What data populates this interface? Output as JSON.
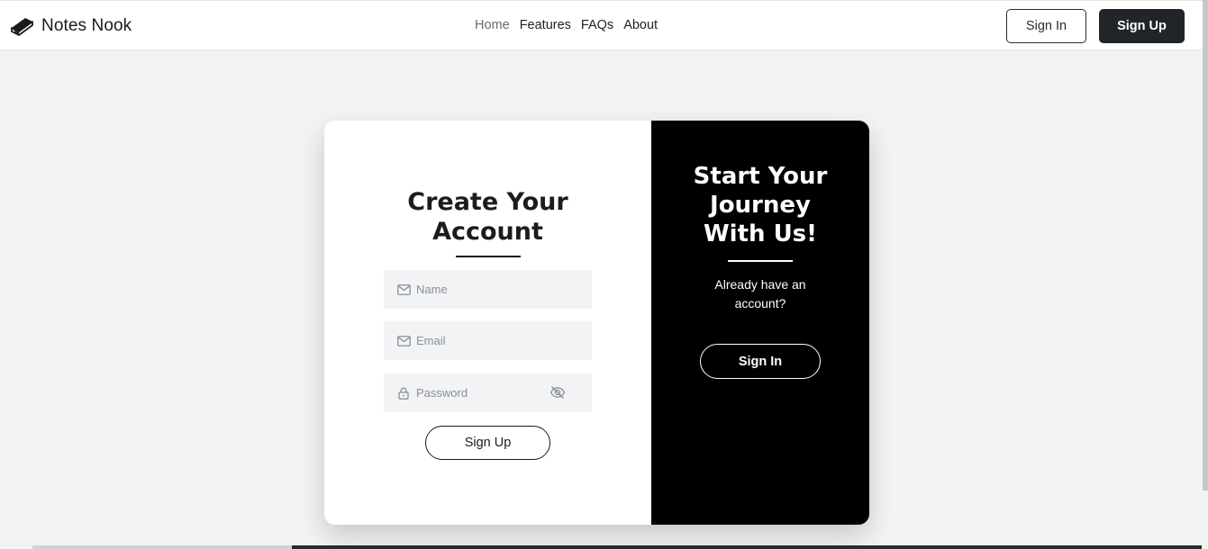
{
  "navbar": {
    "brand_name": "Notes Nook",
    "brand_icon": "book-icon",
    "links": [
      {
        "label": "Home",
        "active": true
      },
      {
        "label": "Features",
        "active": false
      },
      {
        "label": "FAQs",
        "active": false
      },
      {
        "label": "About",
        "active": false
      }
    ],
    "signin_label": "Sign In",
    "signup_label": "Sign Up"
  },
  "signup_form": {
    "title_line1": "Create Your",
    "title_line2": "Account",
    "name_placeholder": "Name",
    "email_placeholder": "Email",
    "password_placeholder": "Password",
    "name_icon": "mail-icon",
    "email_icon": "mail-icon",
    "password_icon": "lock-icon",
    "password_toggle_icon": "eye-slash-icon",
    "submit_label": "Sign Up"
  },
  "promo_panel": {
    "title_line1": "Start Your",
    "title_line2": "Journey",
    "title_line3": "With Us!",
    "subtitle": "Already have an account?",
    "signin_label": "Sign In"
  },
  "colors": {
    "page_bg": "#f2f3f5",
    "dark_panel": "#000000",
    "primary_dark": "#212529"
  }
}
